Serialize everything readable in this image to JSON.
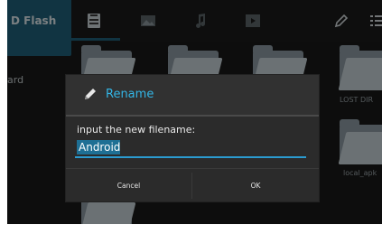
{
  "sidebar": {
    "active_tab": "D Flash",
    "item_partial": "ard"
  },
  "folders": {
    "lost_dir": "LOST DIR",
    "local_apk": "local_apk"
  },
  "dialog": {
    "title": "Rename",
    "prompt": "input the new filename:",
    "input_value": "Android",
    "cancel_label": "Cancel",
    "ok_label": "OK"
  },
  "icons": [
    "file-manager-icon",
    "image-icon",
    "music-icon",
    "video-icon",
    "edit-icon",
    "menu-icon",
    "pencil-icon"
  ],
  "colors": {
    "accent": "#33b5e5",
    "active_tab": "#1f5f78",
    "selection": "#1e6f94"
  }
}
